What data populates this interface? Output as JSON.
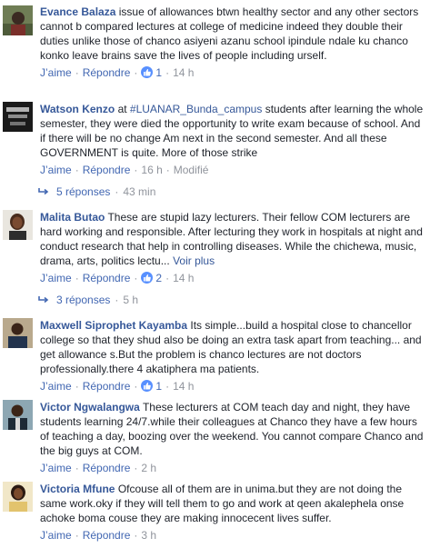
{
  "actions": {
    "like": "J’aime",
    "reply": "Répondre",
    "sep": "·"
  },
  "comments": [
    {
      "name": "Evance Balaza",
      "text": "issue of allowances btwn healthy sector and any other sectors cannot b compared lectures at college of medicine indeed they double their duties unlike those of chanco asiyeni azanu school ipindule ndale ku chanco konko leave brains save the lives of people including urself.",
      "reactions": "1",
      "time": "14 h"
    },
    {
      "name": "Watson Kenzo",
      "text_pre": "at",
      "mention": "#LUANAR_Bunda_campus",
      "text": "students after learning the whole semester, they were died the opportunity to write exam because of school. And if there will be no change Am next in the second semester. And all these GOVERNMENT is quite. More of those strike",
      "time": "16 h",
      "edited": "Modifié",
      "replies": "5 réponses",
      "replies_time": "43 min"
    },
    {
      "name": "Malita Butao",
      "text": "These are stupid lazy lecturers. Their fellow COM lecturers are hard working and responsible. After lecturing they work in hospitals at night and conduct research that help in controlling diseases. While the chichewa, music, drama, arts, politics lectu...",
      "see_more": "Voir plus",
      "reactions": "2",
      "time": "14 h",
      "replies": "3 réponses",
      "replies_time": "5 h"
    },
    {
      "name": "Maxwell Siprophet Kayamba",
      "text": "Its simple...build a hospital close to chancellor college so that they shud also be doing an extra task apart from teaching... and get allowance s.But the problem is chanco lectures are not doctors professionally.there 4 akatiphera ma patients.",
      "reactions": "1",
      "time": "14 h"
    },
    {
      "name": "Victor Ngwalangwa",
      "text": "These lecturers at COM teach day and night, they have students learning 24/7.while their colleagues at Chanco they have a few hours of teaching a day, boozing over the weekend. You cannot compare Chanco and the big guys at COM.",
      "time": "2 h"
    },
    {
      "name": "Victoria Mfune",
      "text": "Ofcouse all of them are in unima.but they are not doing the same work.oky if they will tell them to go and work at qeen akalephela onse achoke boma couse they are making innocecent lives suffer.",
      "time": "3 h"
    }
  ],
  "colors": {
    "link": "#365899",
    "action": "#4267b2",
    "meta": "#90949c",
    "like": "#5890ff"
  }
}
